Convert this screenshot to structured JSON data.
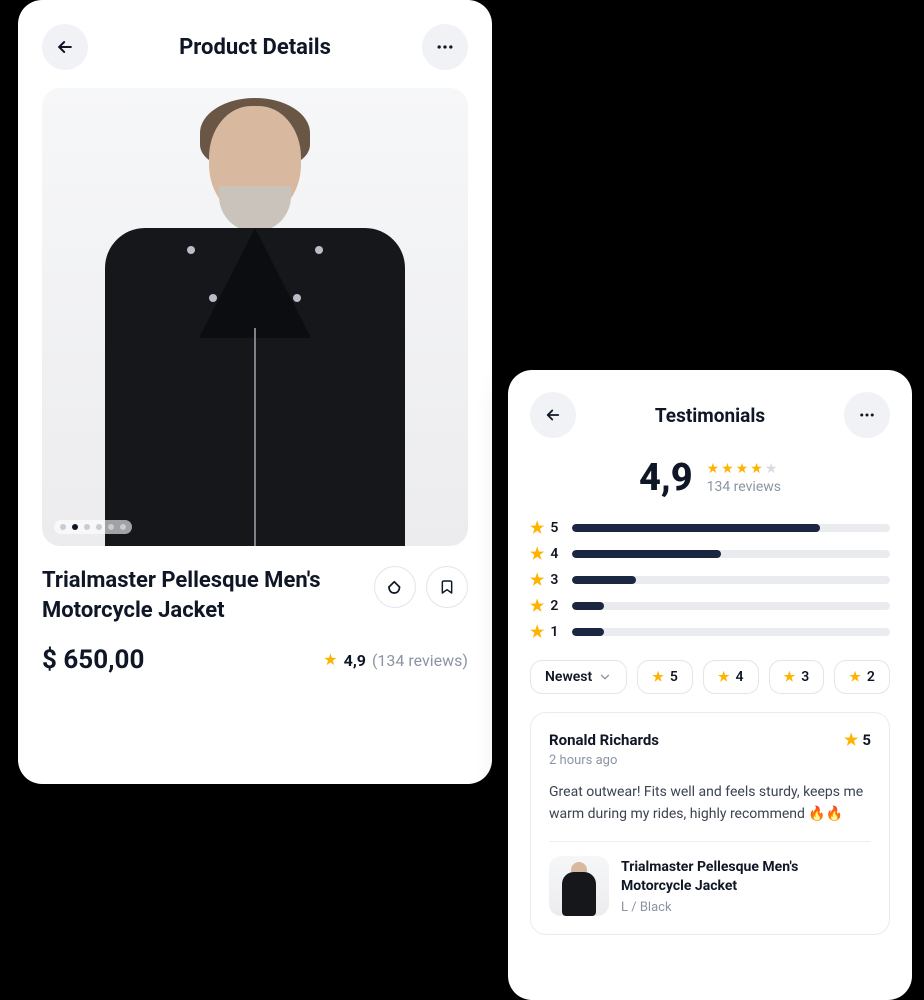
{
  "product": {
    "header_title": "Product Details",
    "title": "Trialmaster Pellesque Men's Motorcycle Jacket",
    "price": "$ 650,00",
    "rating": "4,9",
    "reviews_count": "(134 reviews)",
    "pager_total": 6,
    "pager_active": 1
  },
  "testimonials": {
    "header_title": "Testimonials",
    "rating": "4,9",
    "reviews_text": "134 reviews",
    "distribution": [
      {
        "label": "5",
        "percent": 78
      },
      {
        "label": "4",
        "percent": 47
      },
      {
        "label": "3",
        "percent": 20
      },
      {
        "label": "2",
        "percent": 10
      },
      {
        "label": "1",
        "percent": 10
      }
    ],
    "sort_label": "Newest",
    "filters": [
      "5",
      "4",
      "3",
      "2"
    ],
    "review": {
      "name": "Ronald Richards",
      "score": "5",
      "time": "2 hours ago",
      "text": "Great outwear! Fits well and feels sturdy, keeps me warm during my rides, highly recommend 🔥🔥",
      "product_title": "Trialmaster Pellesque Men's Motorcycle Jacket",
      "variant": "L / Black"
    }
  }
}
